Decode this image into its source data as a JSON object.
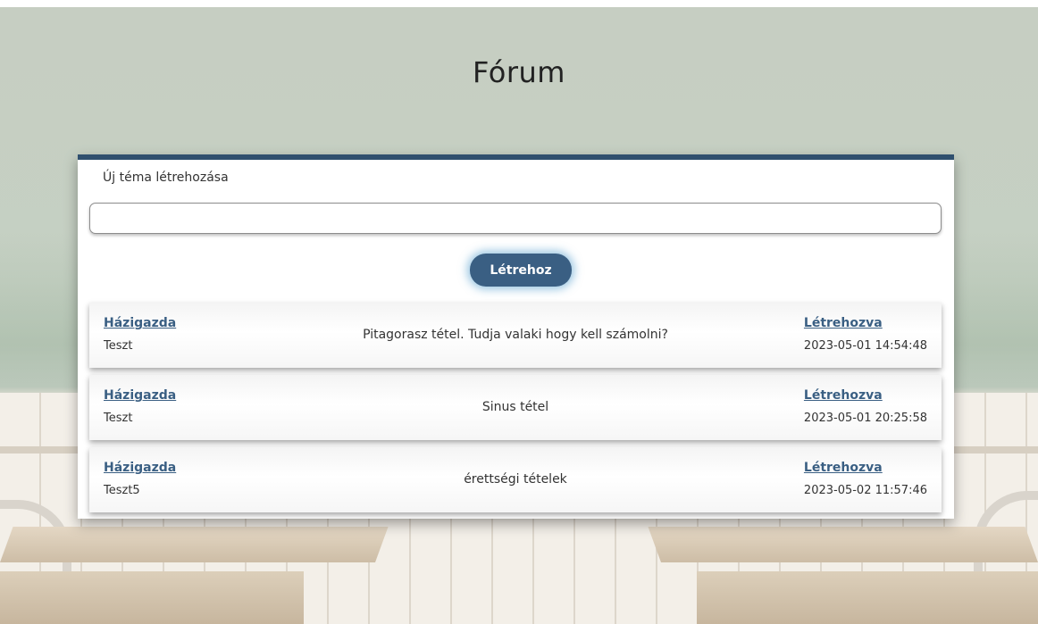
{
  "page": {
    "title": "Fórum"
  },
  "new_topic": {
    "label": "Új téma létrehozása",
    "input_value": "",
    "input_placeholder": "",
    "create_button_label": "Létrehoz"
  },
  "topics": [
    {
      "host_label": "Házigazda",
      "host_name": "Teszt",
      "title": "Pitagorasz tétel. Tudja valaki hogy kell számolni?",
      "created_label": "Létrehozva",
      "created_date": "2023-05-01 14:54:48"
    },
    {
      "host_label": "Házigazda",
      "host_name": "Teszt",
      "title": "Sinus tétel",
      "created_label": "Létrehozva",
      "created_date": "2023-05-01 20:25:58"
    },
    {
      "host_label": "Házigazda",
      "host_name": "Teszt5",
      "title": "érettségi tételek",
      "created_label": "Létrehozva",
      "created_date": "2023-05-02 11:57:46"
    }
  ],
  "colors": {
    "accent": "#3a5f83",
    "card_border": "#2f4f6e",
    "text": "#333333"
  }
}
